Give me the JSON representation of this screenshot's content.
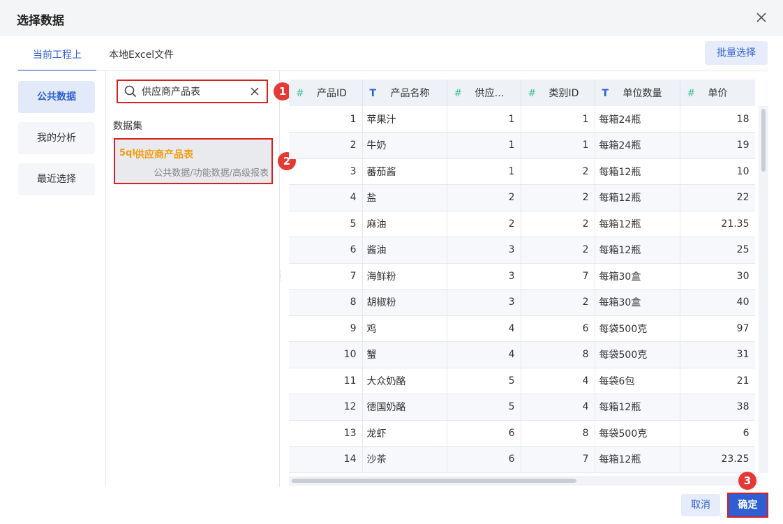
{
  "dialog": {
    "title": "选择数据"
  },
  "tabs": [
    {
      "label": "当前工程上"
    },
    {
      "label": "本地Excel文件"
    }
  ],
  "batch_select": "批量选择",
  "left_nav": [
    {
      "label": "公共数据"
    },
    {
      "label": "我的分析"
    },
    {
      "label": "最近选择"
    }
  ],
  "search": {
    "value": "供应商产品表"
  },
  "section_label": "数据集",
  "dataset": {
    "icon_text": "5ql",
    "name": "供应商产品表",
    "path": "公共数据/功能数据/高级报表"
  },
  "badges": [
    "1",
    "2",
    "3"
  ],
  "columns": [
    {
      "type": "number",
      "type_glyph": "#",
      "label": "产品ID"
    },
    {
      "type": "text",
      "type_glyph": "T",
      "label": "产品名称"
    },
    {
      "type": "number",
      "type_glyph": "#",
      "label": "供应…"
    },
    {
      "type": "number",
      "type_glyph": "#",
      "label": "类别ID"
    },
    {
      "type": "text",
      "type_glyph": "T",
      "label": "单位数量"
    },
    {
      "type": "number",
      "type_glyph": "#",
      "label": "单价"
    }
  ],
  "rows": [
    [
      "1",
      "苹果汁",
      "1",
      "1",
      "每箱24瓶",
      "18"
    ],
    [
      "2",
      "牛奶",
      "1",
      "1",
      "每箱24瓶",
      "19"
    ],
    [
      "3",
      "蕃茄酱",
      "1",
      "2",
      "每箱12瓶",
      "10"
    ],
    [
      "4",
      "盐",
      "2",
      "2",
      "每箱12瓶",
      "22"
    ],
    [
      "5",
      "麻油",
      "2",
      "2",
      "每箱12瓶",
      "21.35"
    ],
    [
      "6",
      "酱油",
      "3",
      "2",
      "每箱12瓶",
      "25"
    ],
    [
      "7",
      "海鲜粉",
      "3",
      "7",
      "每箱30盒",
      "30"
    ],
    [
      "8",
      "胡椒粉",
      "3",
      "2",
      "每箱30盒",
      "40"
    ],
    [
      "9",
      "鸡",
      "4",
      "6",
      "每袋500克",
      "97"
    ],
    [
      "10",
      "蟹",
      "4",
      "8",
      "每袋500克",
      "31"
    ],
    [
      "11",
      "大众奶酪",
      "5",
      "4",
      "每袋6包",
      "21"
    ],
    [
      "12",
      "德国奶酪",
      "5",
      "4",
      "每箱12瓶",
      "38"
    ],
    [
      "13",
      "龙虾",
      "6",
      "8",
      "每袋500克",
      "6"
    ],
    [
      "14",
      "沙茶",
      "6",
      "7",
      "每箱12瓶",
      "23.25"
    ]
  ],
  "footer": {
    "cancel": "取消",
    "ok": "确定"
  },
  "colors": {
    "accent": "#2f5fd3",
    "highlight": "#d92020",
    "dataset": "#f39c12"
  }
}
